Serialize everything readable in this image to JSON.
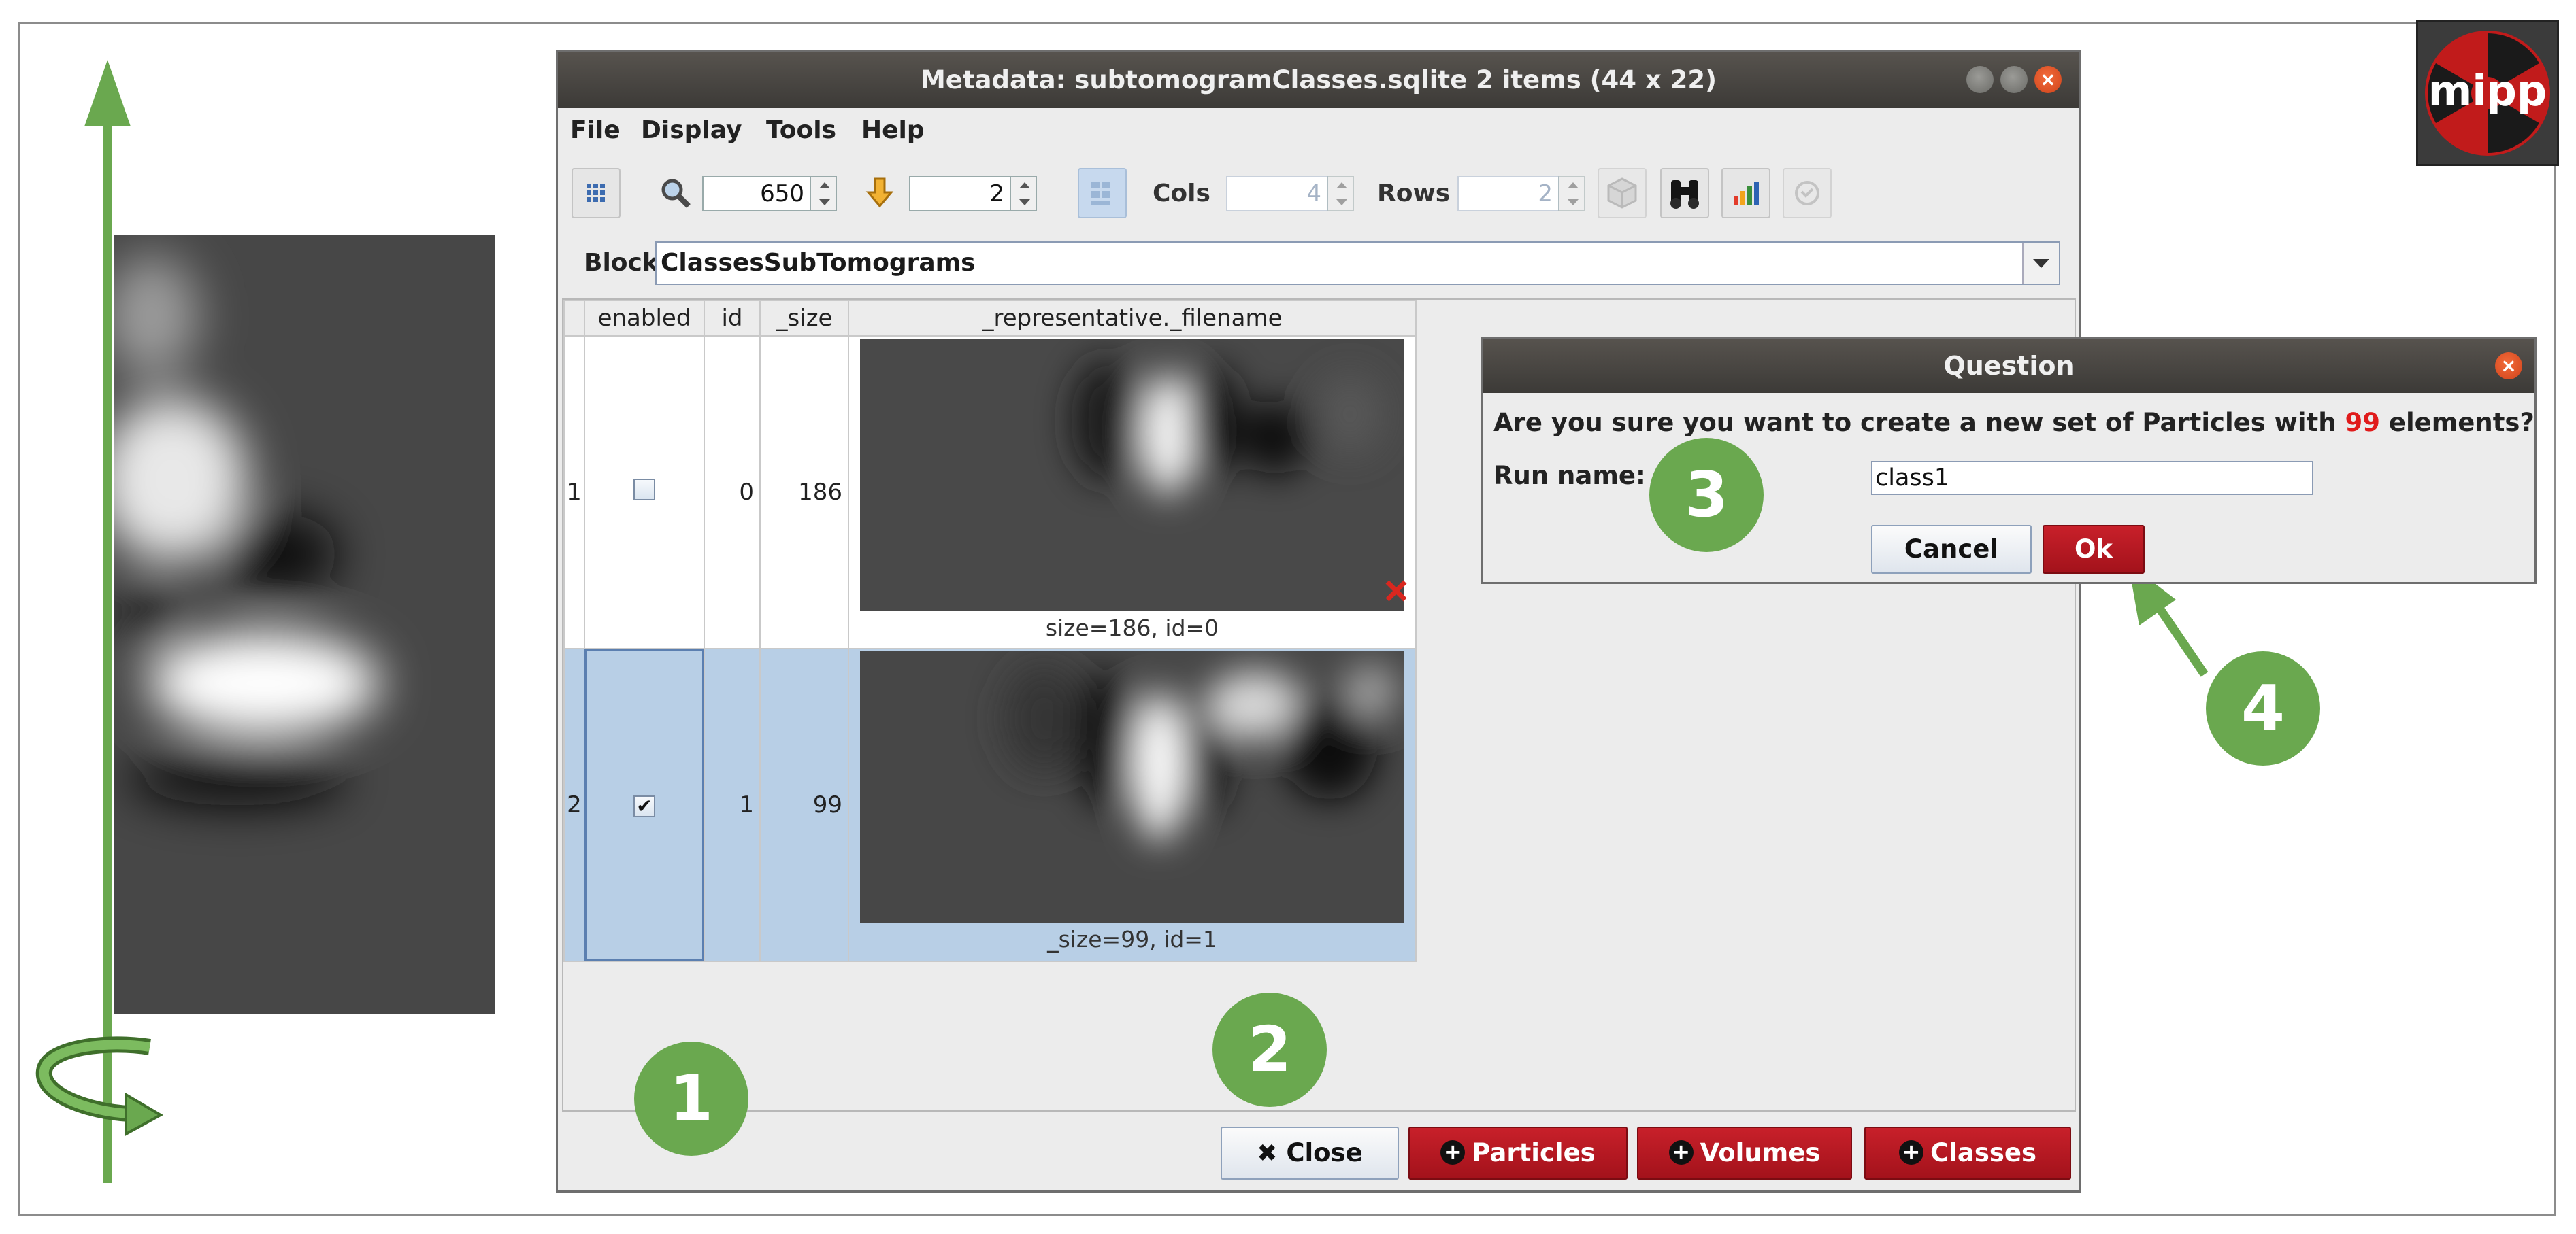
{
  "window": {
    "title": "Metadata: subtomogramClasses.sqlite 2 items (44 x 22)"
  },
  "menu": [
    "File",
    "Display",
    "Tools",
    "Help"
  ],
  "toolbar": {
    "zoom_value": "650",
    "goto_value": "2",
    "cols_label": "Cols",
    "cols_value": "4",
    "rows_label": "Rows",
    "rows_value": "2"
  },
  "block": {
    "label": "Block",
    "value": "ClassesSubTomograms"
  },
  "table": {
    "columns": [
      "enabled",
      "id",
      "_size",
      "_representative._filename"
    ],
    "rows": [
      {
        "row": "1",
        "enabled": false,
        "id": "0",
        "size": "186",
        "caption": "size=186, id=0"
      },
      {
        "row": "2",
        "enabled": true,
        "id": "1",
        "size": "99",
        "caption": "_size=99, id=1"
      }
    ]
  },
  "footer": {
    "close": "Close",
    "particles": "Particles",
    "volumes": "Volumes",
    "classes": "Classes"
  },
  "dialog": {
    "title": "Question",
    "question_prefix": "Are you sure you want to create a new set of Particles with",
    "question_count": "99",
    "question_suffix": "elements?",
    "run_label": "Run name:",
    "run_value": "class1",
    "cancel": "Cancel",
    "ok": "Ok"
  },
  "annotations": [
    "1",
    "2",
    "3",
    "4"
  ],
  "logo": {
    "text": "mipp"
  },
  "colors": {
    "accent_green": "#6aa84f",
    "button_red": "#b0151d",
    "selection_blue": "#b8cfe6",
    "highlight_red": "#e01b1b"
  },
  "icons": [
    "grid-icon",
    "zoom-icon",
    "goto-icon",
    "cube-icon",
    "binoculars-icon",
    "chart-icon",
    "refresh-icon",
    "checkbox-icon",
    "close-x-icon",
    "plus-icon",
    "rotation-arrow-icon"
  ]
}
